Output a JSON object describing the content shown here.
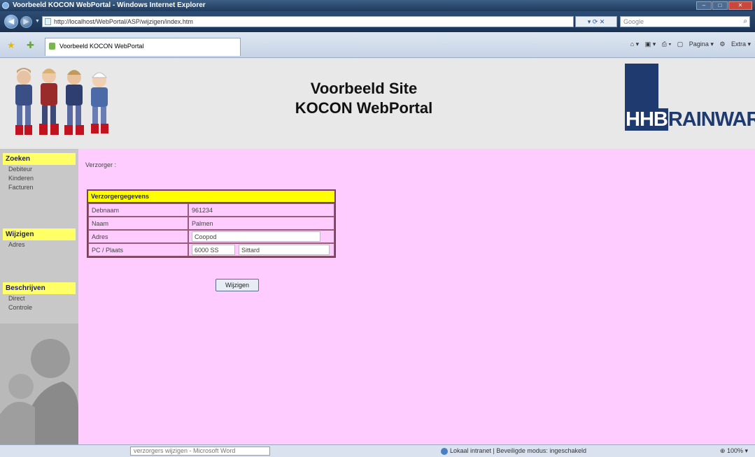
{
  "browser": {
    "title": "Voorbeeld KOCON WebPortal - Windows Internet Explorer",
    "address": "http://localhost/WebPortal/ASP/wijzigen/index.htm",
    "search_placeholder": "Google",
    "tab_label": "Voorbeeld KOCON WebPortal",
    "commands": [
      "Beginpagina",
      "Feeds",
      "Afdrukken",
      "Pagina",
      "Extra"
    ],
    "status_task": "verzorgers wijzigen - Microsoft Word",
    "status_zone": "Lokaal intranet | Beveiligde modus: ingeschakeld",
    "zoom": "100%"
  },
  "header": {
    "title_line1": "Voorbeeld Site",
    "title_line2": "KOCON WebPortal",
    "logo_hhb": "HHB",
    "logo_rest": "RAINWARE"
  },
  "sidebar": {
    "sections": [
      {
        "title": "Zoeken",
        "items": [
          "Debiteur",
          "Kinderen",
          "Facturen"
        ]
      },
      {
        "title": "Wijzigen",
        "items": [
          "Adres"
        ]
      },
      {
        "title": "Beschrijven",
        "items": [
          "Direct",
          "Controle"
        ]
      }
    ]
  },
  "main": {
    "verzorger_label": "Verzorger :",
    "form": {
      "header": "Verzorgergegevens",
      "rows": [
        {
          "label": "Debnaam",
          "value": "961234"
        },
        {
          "label": "Naam",
          "value": "Palmen"
        },
        {
          "label": "Adres",
          "value": "Coopod"
        },
        {
          "label": "PC / Plaats",
          "pc": "6000 SS",
          "plaats": "Sittard"
        }
      ]
    },
    "submit_label": "Wijzigen"
  },
  "colors": {
    "content_bg": "#ffccff",
    "section_header": "#ffff66",
    "sidebar_bg": "#c8c8c8",
    "logo_blue": "#1f3a6e"
  }
}
